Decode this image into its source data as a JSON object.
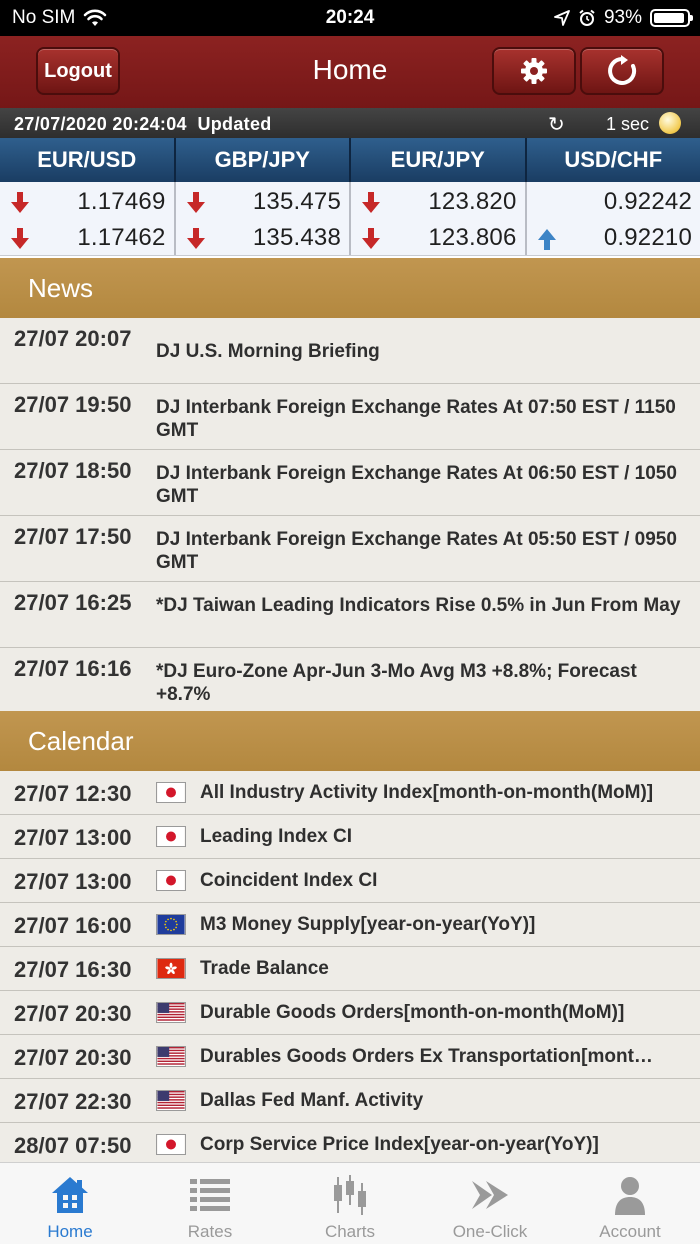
{
  "status_bar": {
    "carrier": "No SIM",
    "time": "20:24",
    "battery": "93%",
    "battery_level": 0.93
  },
  "header": {
    "title": "Home",
    "logout_label": "Logout",
    "settings_icon": "gear-icon",
    "refresh_icon": "refresh-icon"
  },
  "update_bar": {
    "timestamp": "27/07/2020 20:24:04",
    "status": "Updated",
    "interval": "1 sec"
  },
  "rates": [
    {
      "pair": "EUR/USD",
      "bid": "1.17469",
      "bid_dir": "down",
      "ask": "1.17462",
      "ask_dir": "down"
    },
    {
      "pair": "GBP/JPY",
      "bid": "135.475",
      "bid_dir": "down",
      "ask": "135.438",
      "ask_dir": "down"
    },
    {
      "pair": "EUR/JPY",
      "bid": "123.820",
      "bid_dir": "down",
      "ask": "123.806",
      "ask_dir": "down"
    },
    {
      "pair": "USD/CHF",
      "bid": "0.92242",
      "bid_dir": "none",
      "ask": "0.92210",
      "ask_dir": "up"
    }
  ],
  "news": {
    "title": "News",
    "items": [
      {
        "time": "27/07 20:07",
        "headline": "DJ U.S. Morning Briefing"
      },
      {
        "time": "27/07 19:50",
        "headline": "DJ Interbank Foreign Exchange Rates At 07:50 EST / 1150 GMT"
      },
      {
        "time": "27/07 18:50",
        "headline": "DJ Interbank Foreign Exchange Rates At 06:50 EST / 1050 GMT"
      },
      {
        "time": "27/07 17:50",
        "headline": "DJ Interbank Foreign Exchange Rates At 05:50 EST / 0950 GMT"
      },
      {
        "time": "27/07 16:25",
        "headline": "*DJ Taiwan Leading Indicators Rise 0.5% in Jun From May"
      },
      {
        "time": "27/07 16:16",
        "headline": "*DJ Euro-Zone Apr-Jun 3-Mo Avg M3 +8.8%; Forecast +8.7%"
      }
    ]
  },
  "calendar": {
    "title": "Calendar",
    "items": [
      {
        "time": "27/07 12:30",
        "flag": "japan-flag-icon",
        "event": "All Industry Activity Index[month-on-month(MoM)]"
      },
      {
        "time": "27/07 13:00",
        "flag": "japan-flag-icon",
        "event": "Leading Index CI"
      },
      {
        "time": "27/07 13:00",
        "flag": "japan-flag-icon",
        "event": "Coincident Index CI"
      },
      {
        "time": "27/07 16:00",
        "flag": "eu-flag-icon",
        "event": "M3 Money Supply[year-on-year(YoY)]"
      },
      {
        "time": "27/07 16:30",
        "flag": "hong-kong-flag-icon",
        "event": "Trade Balance"
      },
      {
        "time": "27/07 20:30",
        "flag": "us-flag-icon",
        "event": "Durable Goods Orders[month-on-month(MoM)]"
      },
      {
        "time": "27/07 20:30",
        "flag": "us-flag-icon",
        "event": "Durables Goods Orders Ex Transportation[mont…"
      },
      {
        "time": "27/07 22:30",
        "flag": "us-flag-icon",
        "event": "Dallas Fed Manf. Activity"
      },
      {
        "time": "28/07 07:50",
        "flag": "japan-flag-icon",
        "event": "Corp Service Price Index[year-on-year(YoY)]"
      }
    ]
  },
  "tabs": [
    {
      "label": "Home",
      "icon": "home-icon",
      "active": true
    },
    {
      "label": "Rates",
      "icon": "list-icon",
      "active": false
    },
    {
      "label": "Charts",
      "icon": "candlestick-icon",
      "active": false
    },
    {
      "label": "One-Click",
      "icon": "fast-forward-icon",
      "active": false
    },
    {
      "label": "Account",
      "icon": "person-icon",
      "active": false
    }
  ],
  "colors": {
    "header_red": "#8c2221",
    "section_gold": "#c19650",
    "rates_blue": "#2f5f8d",
    "down_red": "#c62828",
    "up_blue": "#3d84c6",
    "active_tab": "#2a7ad0"
  }
}
